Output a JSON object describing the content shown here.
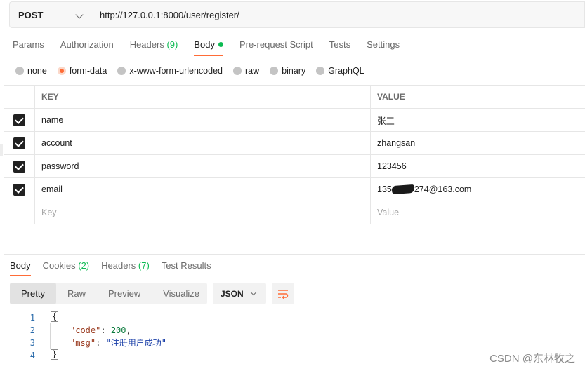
{
  "request": {
    "method": "POST",
    "url": "http://127.0.0.1:8000/user/register/"
  },
  "request_tabs": [
    {
      "label": "Params"
    },
    {
      "label": "Authorization"
    },
    {
      "label": "Headers",
      "count": "(9)"
    },
    {
      "label": "Body"
    },
    {
      "label": "Pre-request Script"
    },
    {
      "label": "Tests"
    },
    {
      "label": "Settings"
    }
  ],
  "body_types": [
    "none",
    "form-data",
    "x-www-form-urlencoded",
    "raw",
    "binary",
    "GraphQL"
  ],
  "selected_body_type": "form-data",
  "table": {
    "headers": {
      "key": "KEY",
      "value": "VALUE"
    },
    "rows": [
      {
        "key": "name",
        "value": "张三",
        "checked": true
      },
      {
        "key": "account",
        "value": "zhangsan",
        "checked": true
      },
      {
        "key": "password",
        "value": "123456",
        "checked": true
      },
      {
        "key": "email",
        "value_prefix": "135",
        "value_suffix": "274@163.com",
        "checked": true
      }
    ],
    "placeholder": {
      "key": "Key",
      "value": "Value"
    }
  },
  "response_tabs": [
    {
      "label": "Body"
    },
    {
      "label": "Cookies",
      "count": "(2)"
    },
    {
      "label": "Headers",
      "count": "(7)"
    },
    {
      "label": "Test Results"
    }
  ],
  "view_modes": [
    "Pretty",
    "Raw",
    "Preview",
    "Visualize"
  ],
  "format": "JSON",
  "code": {
    "line_numbers": [
      "1",
      "2",
      "3",
      "4"
    ],
    "open": "{",
    "close": "}",
    "code_key": "\"code\"",
    "code_val": "200",
    "msg_key": "\"msg\"",
    "msg_val": "\"注册用户成功\""
  },
  "watermark": "CSDN @东林牧之",
  "colors": {
    "accent": "#ff6c37",
    "count_green": "#0cbb52"
  }
}
